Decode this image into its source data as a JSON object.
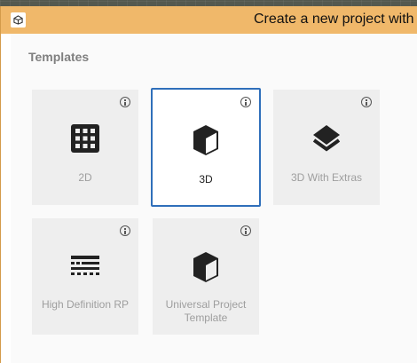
{
  "window": {
    "title": "Create a new project with U"
  },
  "section": {
    "heading": "Templates"
  },
  "templates": [
    {
      "label": "2D",
      "icon": "grid-icon",
      "selected": false
    },
    {
      "label": "3D",
      "icon": "cube-icon",
      "selected": true
    },
    {
      "label": "3D With Extras",
      "icon": "layers-icon",
      "selected": false
    },
    {
      "label": "High Definition RP",
      "icon": "hdrp-icon",
      "selected": false
    },
    {
      "label": "Universal Project Template",
      "icon": "cube-icon",
      "selected": false
    }
  ],
  "colors": {
    "titlebar": "#f0b86a",
    "selection_border": "#2f6fba",
    "card_bg": "#eeeeee"
  }
}
